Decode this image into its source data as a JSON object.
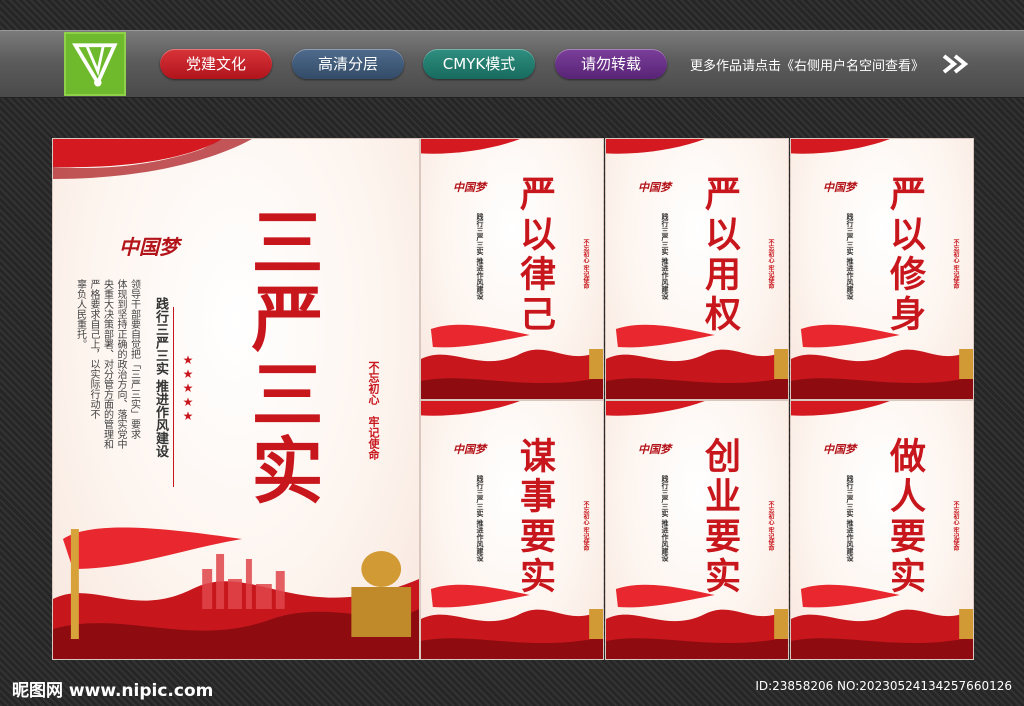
{
  "header": {
    "tags": [
      "党建文化",
      "高清分层",
      "CMYK模式",
      "请勿转载"
    ],
    "more_text": "更多作品请点击《右侧用户名空间查看》"
  },
  "main_poster": {
    "title": "三严三实",
    "dream": "中国梦",
    "subhead": "践行三严三实 推进作风建设",
    "body": [
      "领导干部要自觉把「三严三实」要求",
      "体现到坚持正确的政治方向、落实党中",
      "央重大决策部署、对分管方面的管理和",
      "严格要求自己上，以实际行动不",
      "辜负人民重托。"
    ],
    "seal": [
      "不忘初心",
      "牢记使命"
    ]
  },
  "posters": [
    {
      "title": "严以律己"
    },
    {
      "title": "严以用权"
    },
    {
      "title": "严以修身"
    },
    {
      "title": "谋事要实"
    },
    {
      "title": "创业要实"
    },
    {
      "title": "做人要实"
    }
  ],
  "footer": {
    "site": "昵图网 www.nipic.com",
    "id": "ID:23858206 NO:20230524134257660126"
  },
  "colors": {
    "accent": "#c8161d",
    "brand_green": "#6fba2c"
  }
}
